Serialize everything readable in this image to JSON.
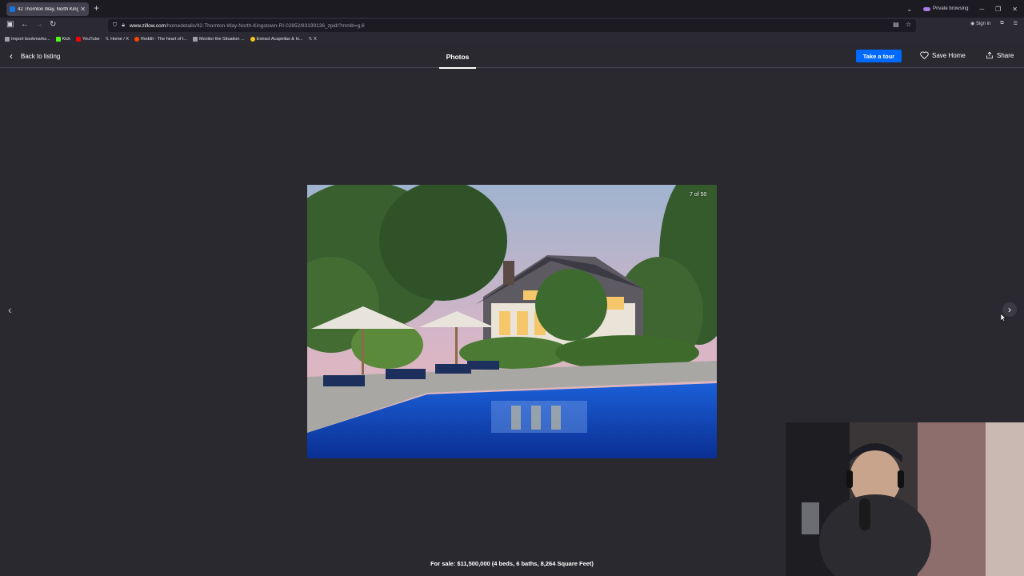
{
  "browser": {
    "tab_title": "42 Thornton Way, North Kingst...",
    "tab_close": "✕",
    "new_tab": "+",
    "private_label": "Private browsing",
    "url_host": "www.zillow.com",
    "url_path": "/homedetails/42-Thornton-Way-North-Kingstown-RI-02852/83199136_zpid/?mmlb=g,6",
    "sign_in": "Sign in",
    "bookmarks": [
      {
        "label": "Import bookmarks...",
        "color": "#9e9ea6"
      },
      {
        "label": "Kick",
        "color": "#53fc18"
      },
      {
        "label": "YouTube",
        "color": "#ff0000"
      },
      {
        "label": "Home / X",
        "color": "#ffffff"
      },
      {
        "label": "Reddit - The heart of t...",
        "color": "#ff4500"
      },
      {
        "label": "Monitor the Situation ...",
        "color": "#9e9ea6"
      },
      {
        "label": "Extract Acapellas & In...",
        "color": "#f5c518"
      },
      {
        "label": "X",
        "color": "#ffffff"
      }
    ]
  },
  "viewer": {
    "back_label": "Back to listing",
    "tab_label": "Photos",
    "tour_label": "Take a tour",
    "save_label": "Save Home",
    "share_label": "Share",
    "photo_counter": "7 of 50",
    "caption": "For sale: $11,500,000 (4 beds, 6 baths, 8,264 Square Feet)"
  },
  "colors": {
    "page_bg": "#2a2930",
    "accent": "#006aff"
  }
}
